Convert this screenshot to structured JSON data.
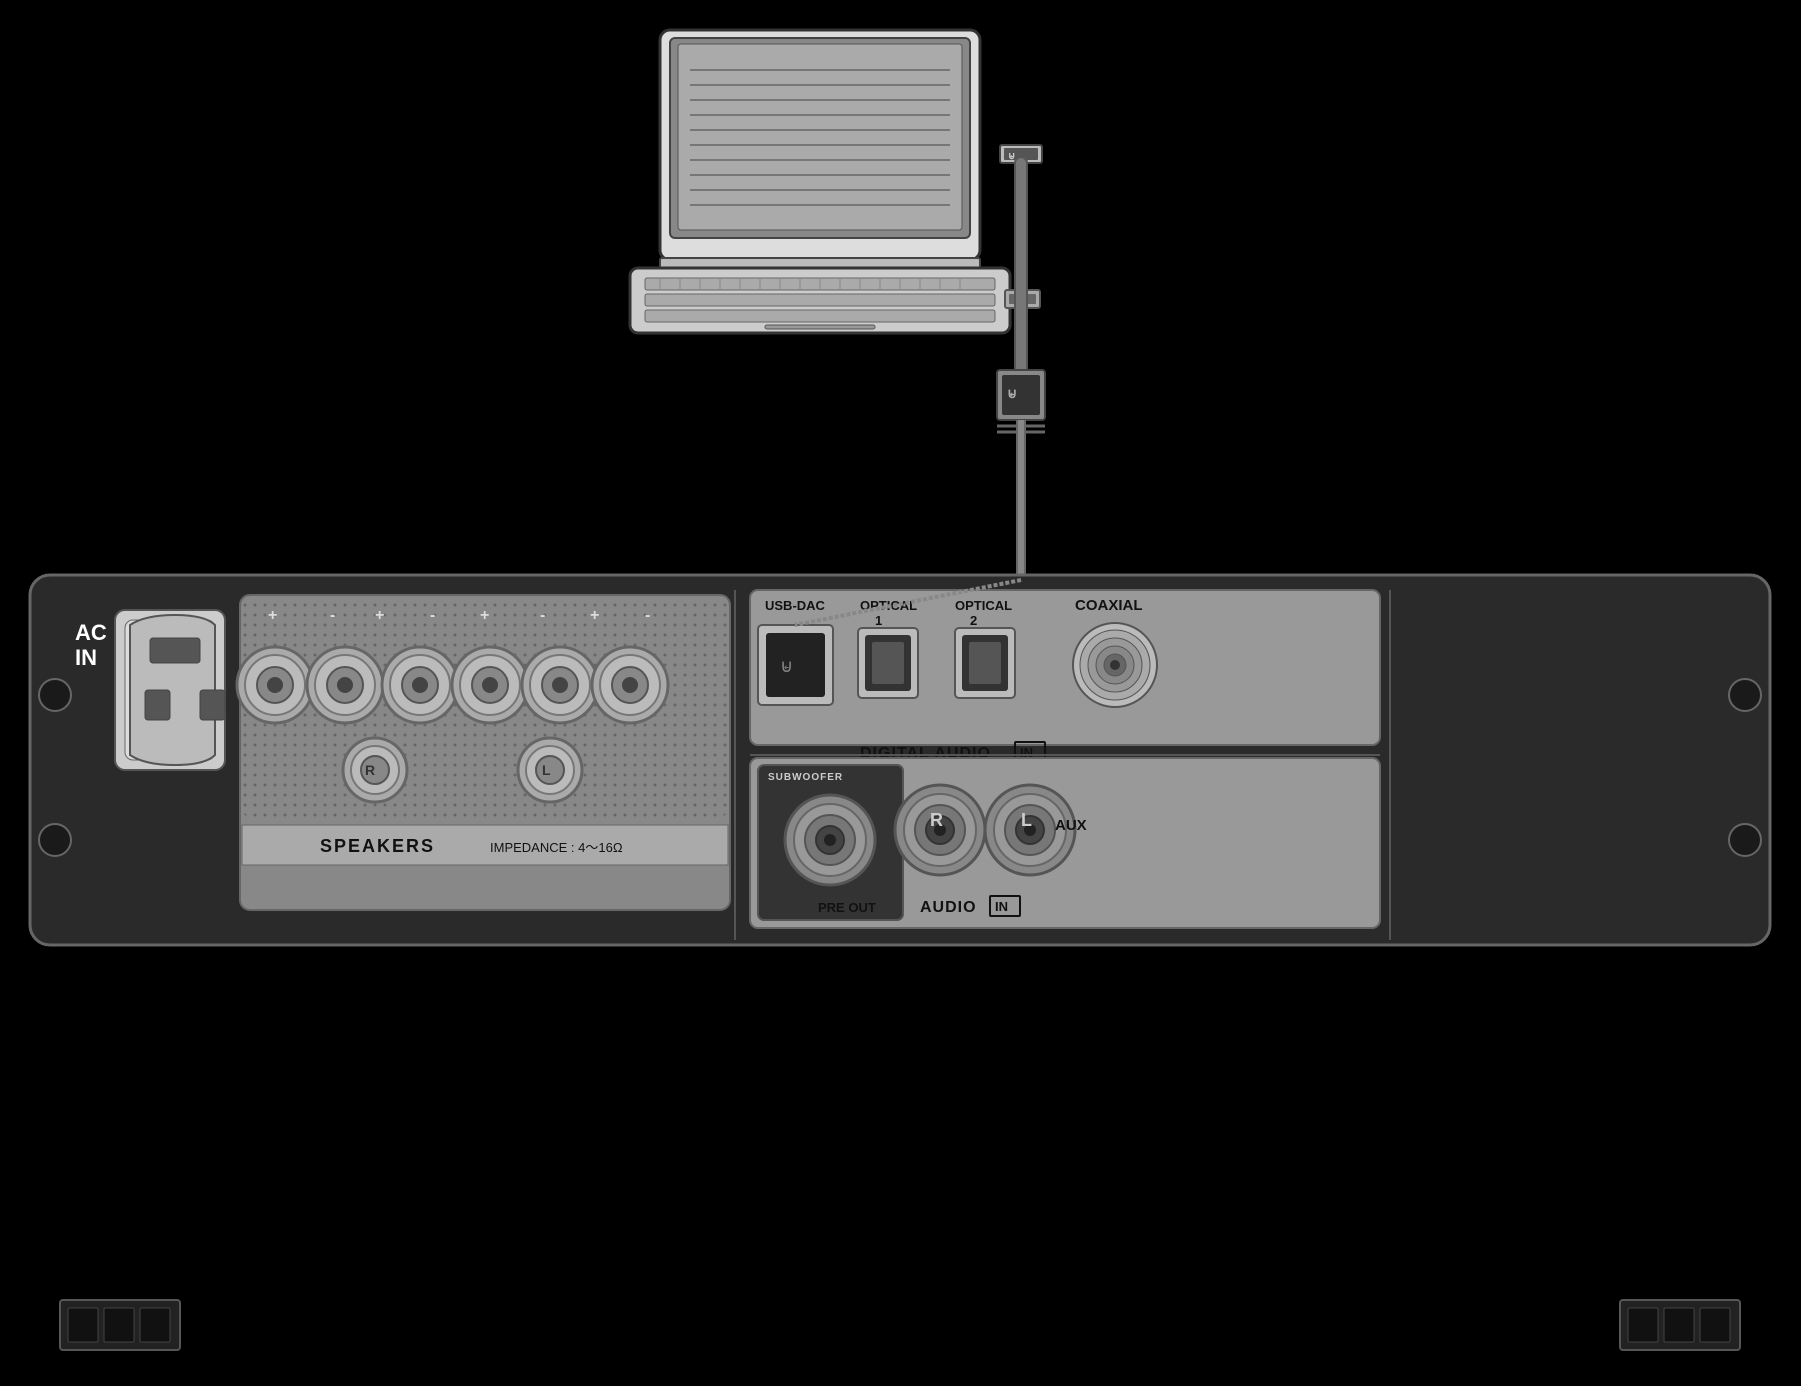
{
  "labels": {
    "ac_in": "AC\nIN",
    "ac_in_line1": "AC",
    "ac_in_line2": "IN",
    "usb_dac": "USB-DAC",
    "optical_1": "OPTICAL",
    "optical_1_num": "1",
    "optical_2": "OPTICAL",
    "optical_2_num": "2",
    "coaxial": "COAXIAL",
    "digital_audio_in": "DIGITAL AUDIO",
    "in_badge": "IN",
    "speakers": "SPEAKERS",
    "impedance": "IMPEDANCE : 4～16Ω",
    "r_terminal": "R",
    "l_terminal": "L",
    "subwoofer": "SUBWOOFER",
    "pre_out": "PRE OUT",
    "audio_in": "AUDIO",
    "in_badge2": "IN",
    "r_rca": "R",
    "l_rca": "L",
    "aux": "AUX",
    "usb_symbol": "⊌"
  },
  "colors": {
    "background": "#000000",
    "panel_bg": "#2a2a2a",
    "panel_border": "#555555",
    "section_bg": "#999999",
    "dark_section": "#333333",
    "white_text": "#ffffff",
    "black_text": "#111111",
    "connector_bg": "#aaaaaa"
  }
}
